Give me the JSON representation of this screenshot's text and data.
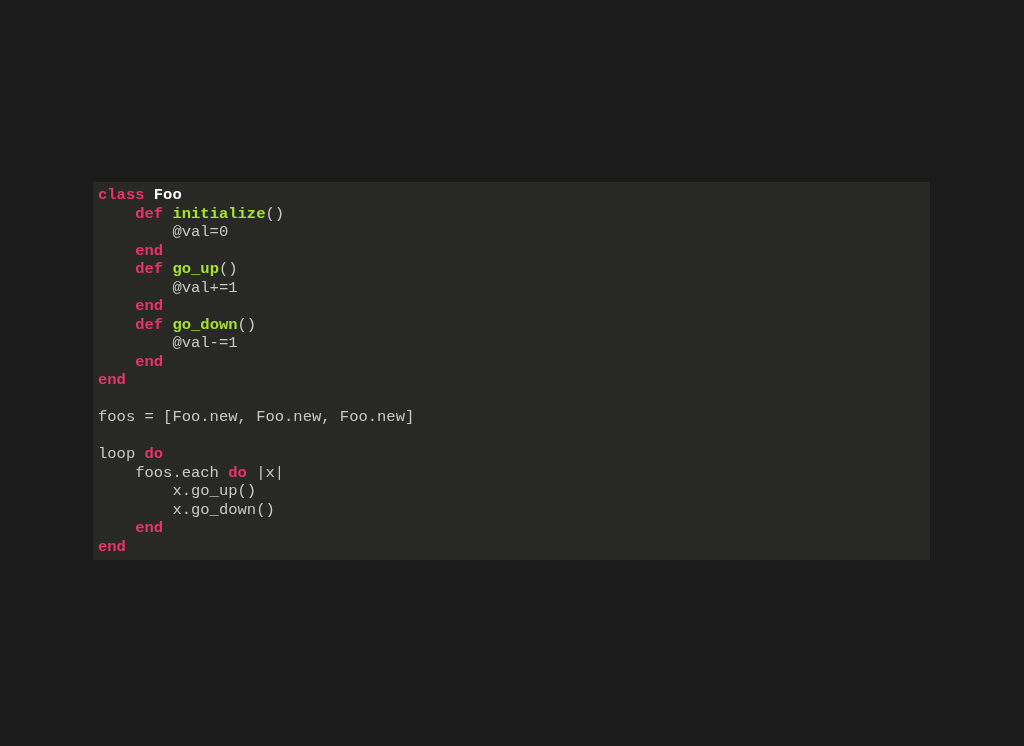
{
  "code_block": {
    "lines": [
      {
        "kind": "code",
        "tokens": [
          {
            "kind": "keyword",
            "text": "class "
          },
          {
            "kind": "name",
            "text": "Foo"
          }
        ]
      },
      {
        "kind": "code",
        "tokens": [
          {
            "kind": "keyword",
            "text": "    def "
          },
          {
            "kind": "function",
            "text": "initialize"
          },
          {
            "kind": "plain",
            "text": "()"
          }
        ]
      },
      {
        "kind": "code",
        "tokens": [
          {
            "kind": "plain",
            "text": "        @val=0"
          }
        ]
      },
      {
        "kind": "code",
        "tokens": [
          {
            "kind": "keyword",
            "text": "    end"
          }
        ]
      },
      {
        "kind": "code",
        "tokens": [
          {
            "kind": "keyword",
            "text": "    def "
          },
          {
            "kind": "function",
            "text": "go_up"
          },
          {
            "kind": "plain",
            "text": "()"
          }
        ]
      },
      {
        "kind": "code",
        "tokens": [
          {
            "kind": "plain",
            "text": "        @val+=1"
          }
        ]
      },
      {
        "kind": "code",
        "tokens": [
          {
            "kind": "keyword",
            "text": "    end"
          }
        ]
      },
      {
        "kind": "code",
        "tokens": [
          {
            "kind": "keyword",
            "text": "    def "
          },
          {
            "kind": "function",
            "text": "go_down"
          },
          {
            "kind": "plain",
            "text": "()"
          }
        ]
      },
      {
        "kind": "code",
        "tokens": [
          {
            "kind": "plain",
            "text": "        @val-=1"
          }
        ]
      },
      {
        "kind": "code",
        "tokens": [
          {
            "kind": "keyword",
            "text": "    end"
          }
        ]
      },
      {
        "kind": "code",
        "tokens": [
          {
            "kind": "keyword",
            "text": "end"
          }
        ]
      },
      {
        "kind": "blank"
      },
      {
        "kind": "code",
        "tokens": [
          {
            "kind": "plain",
            "text": "foos = [Foo.new, Foo.new, Foo.new]"
          }
        ]
      },
      {
        "kind": "blank"
      },
      {
        "kind": "code",
        "tokens": [
          {
            "kind": "plain",
            "text": "loop "
          },
          {
            "kind": "keyword",
            "text": "do"
          }
        ]
      },
      {
        "kind": "code",
        "tokens": [
          {
            "kind": "plain",
            "text": "    foos.each "
          },
          {
            "kind": "keyword",
            "text": "do"
          },
          {
            "kind": "plain",
            "text": " |x|"
          }
        ]
      },
      {
        "kind": "code",
        "tokens": [
          {
            "kind": "plain",
            "text": "        x.go_up()"
          }
        ]
      },
      {
        "kind": "code",
        "tokens": [
          {
            "kind": "plain",
            "text": "        x.go_down()"
          }
        ]
      },
      {
        "kind": "code",
        "tokens": [
          {
            "kind": "keyword",
            "text": "    end"
          }
        ]
      },
      {
        "kind": "code",
        "tokens": [
          {
            "kind": "keyword",
            "text": "end"
          }
        ]
      }
    ]
  }
}
